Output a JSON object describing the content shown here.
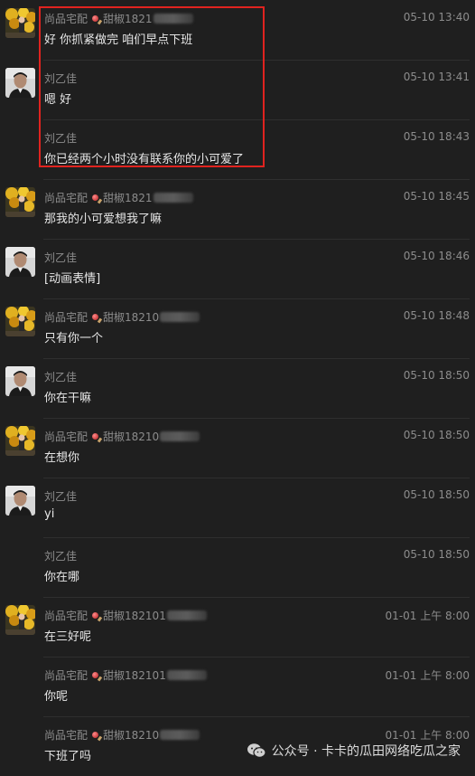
{
  "messages": [
    {
      "sender": "尚品宅配",
      "nick": "甜椒1821",
      "time": "05-10 13:40",
      "text": "好 你抓紧做完 咱们早点下班",
      "avatar": "store"
    },
    {
      "sender": "刘乙佳",
      "nick": "",
      "time": "05-10 13:41",
      "text": "嗯 好",
      "avatar": "person"
    },
    {
      "sender": "刘乙佳",
      "nick": "",
      "time": "05-10 18:43",
      "text": "你已经两个小时没有联系你的小可爱了",
      "avatar": "none"
    },
    {
      "sender": "尚品宅配",
      "nick": "甜椒1821",
      "time": "05-10 18:45",
      "text": "那我的小可爱想我了嘛",
      "avatar": "store"
    },
    {
      "sender": "刘乙佳",
      "nick": "",
      "time": "05-10 18:46",
      "text": "[动画表情]",
      "avatar": "person"
    },
    {
      "sender": "尚品宅配",
      "nick": "甜椒18210",
      "time": "05-10 18:48",
      "text": "只有你一个",
      "avatar": "store"
    },
    {
      "sender": "刘乙佳",
      "nick": "",
      "time": "05-10 18:50",
      "text": "你在干嘛",
      "avatar": "person"
    },
    {
      "sender": "尚品宅配",
      "nick": "甜椒18210",
      "time": "05-10 18:50",
      "text": "在想你",
      "avatar": "store"
    },
    {
      "sender": "刘乙佳",
      "nick": "",
      "time": "05-10 18:50",
      "text": "yi",
      "avatar": "person"
    },
    {
      "sender": "刘乙佳",
      "nick": "",
      "time": "05-10 18:50",
      "text": "你在哪",
      "avatar": "none"
    },
    {
      "sender": "尚品宅配",
      "nick": "甜椒182101",
      "time": "01-01 上午 8:00",
      "text": "在三好呢",
      "avatar": "store"
    },
    {
      "sender": "尚品宅配",
      "nick": "甜椒182101",
      "time": "01-01 上午 8:00",
      "text": "你呢",
      "avatar": "none"
    },
    {
      "sender": "尚品宅配",
      "nick": "甜椒18210",
      "time": "01-01 上午 8:00",
      "text": "下班了吗",
      "avatar": "none"
    }
  ],
  "watermark": {
    "label": "公众号 · 卡卡的瓜田网络吃瓜之家",
    "icon": "wechat-icon"
  },
  "colors": {
    "background": "#1f1f1f",
    "highlight": "#e0231f",
    "meta": "#8c8c8c",
    "text": "#e6e6e6"
  }
}
